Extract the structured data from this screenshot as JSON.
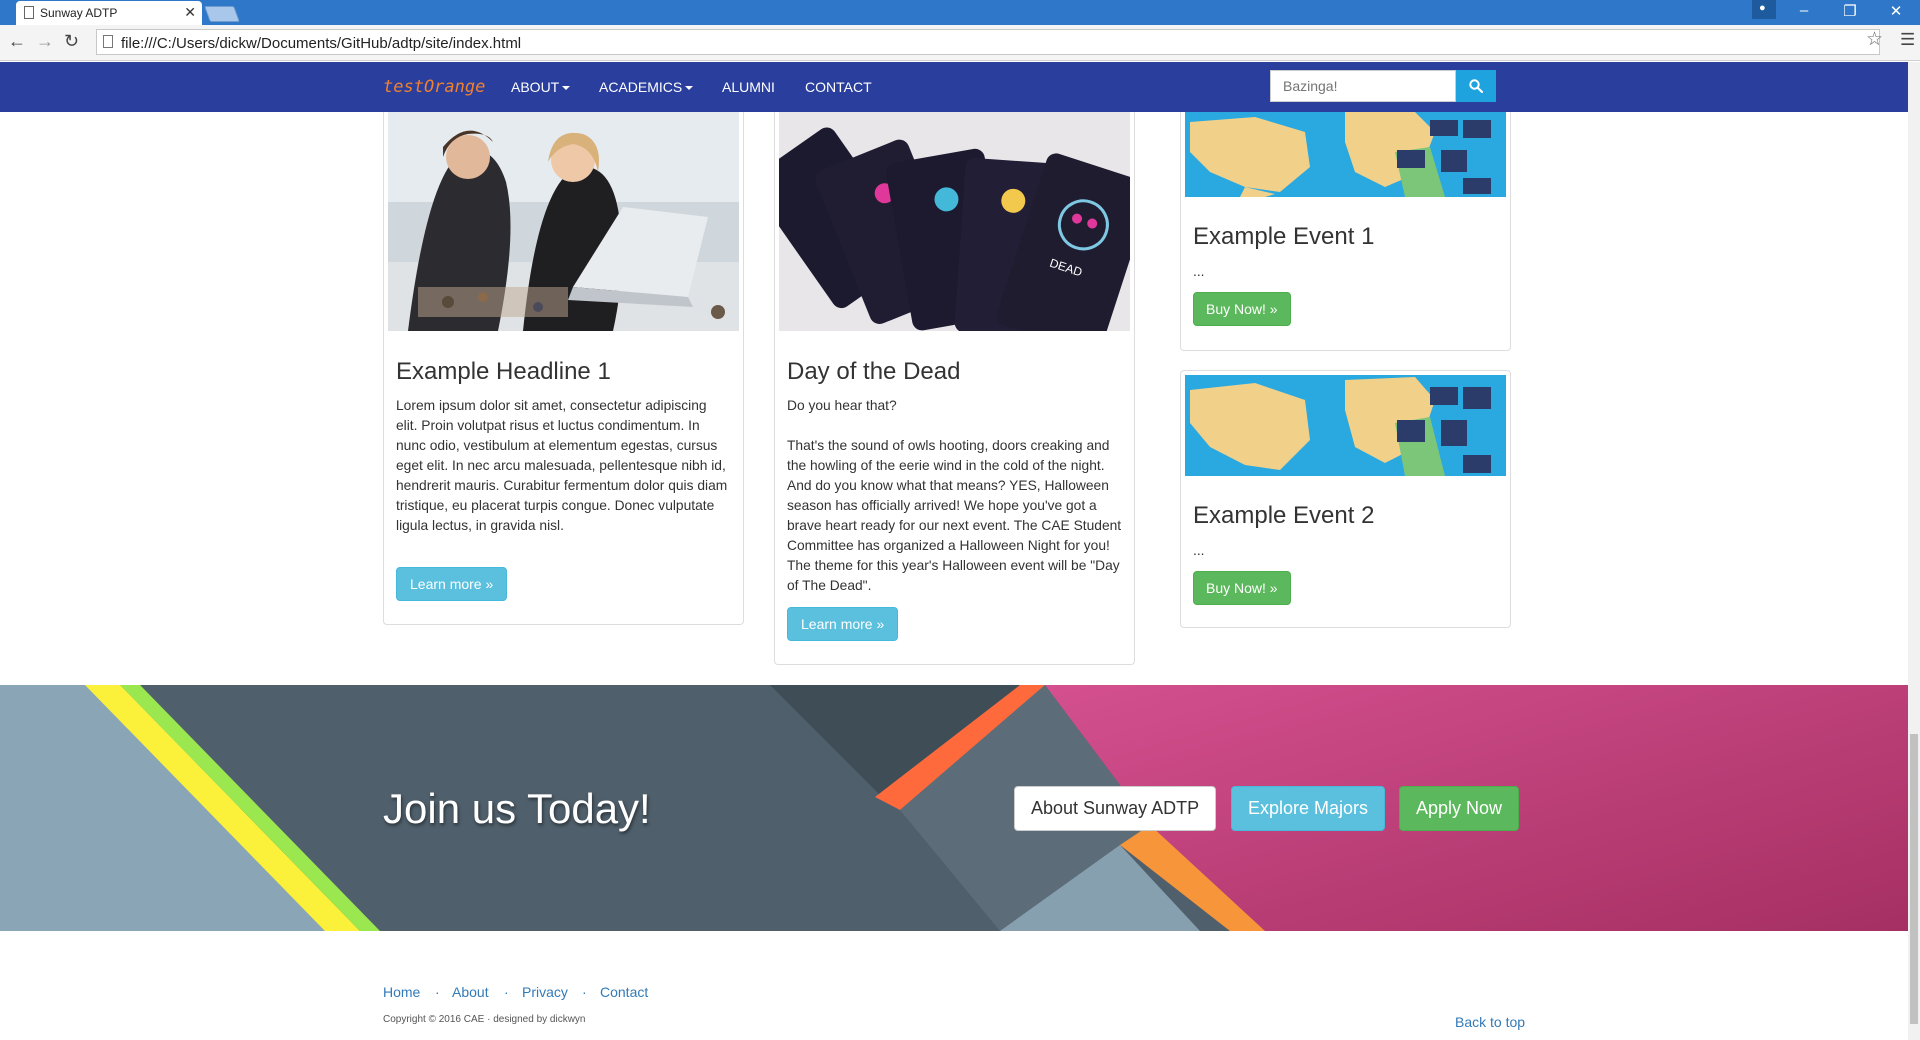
{
  "browser": {
    "tab_title": "Sunway ADTP",
    "url": "file:///C:/Users/dickw/Documents/GitHub/adtp/site/index.html"
  },
  "navbar": {
    "brand": "testOrange",
    "links": [
      "ABOUT",
      "ACADEMICS",
      "ALUMNI",
      "CONTACT"
    ],
    "search_placeholder": "Bazinga!"
  },
  "cards": [
    {
      "title": "Example Headline 1",
      "text": "Lorem ipsum dolor sit amet, consectetur adipiscing elit. Proin volutpat risus et luctus condimentum. In nunc odio, vestibulum at elementum egestas, cursus eget elit. In nec arcu malesuada, pellentesque nibh id, hendrerit mauris. Curabitur fermentum dolor quis diam tristique, eu placerat turpis congue. Donec vulputate ligula lectus, in gravida nisl.",
      "button": "Learn more »"
    },
    {
      "title": "Day of the Dead",
      "text": "Do you hear that?\n\nThat's the sound of owls hooting, doors creaking and the howling of the eerie wind in the cold of the night. And do you know what that means? YES, Halloween season has officially arrived! We hope you've got a brave heart ready for our next event. The CAE Student Committee has organized a Halloween Night for you! The theme for this year's Halloween event will be \"Day of The Dead\".",
      "button": "Learn more »"
    }
  ],
  "events": [
    {
      "title": "Example Event 1",
      "text": "...",
      "button": "Buy Now! »"
    },
    {
      "title": "Example Event 2",
      "text": "...",
      "button": "Buy Now! »"
    }
  ],
  "cta": {
    "title": "Join us Today!",
    "buttons": [
      "About Sunway ADTP",
      "Explore Majors",
      "Apply Now"
    ]
  },
  "footer": {
    "links": [
      "Home",
      "About",
      "Privacy",
      "Contact"
    ],
    "copyright": "Copyright © 2016 CAE · designed by dickwyn",
    "back_to_top": "Back to top"
  },
  "colors": {
    "navbar": "#293e9d",
    "brand": "#f0812f",
    "info": "#5bc0de",
    "success": "#5cb85c",
    "link": "#337ab7"
  }
}
